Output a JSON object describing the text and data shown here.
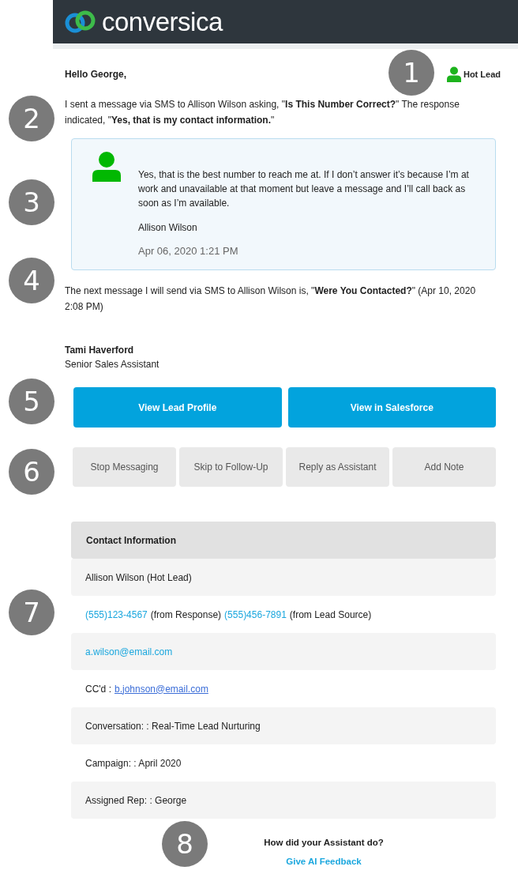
{
  "header": {
    "logo_text": "conversica"
  },
  "greeting": "Hello George,",
  "lead_status": {
    "label": "Hot Lead",
    "color": "#1db31d"
  },
  "intro": "I sent a message via SMS to Allison Wilson asking, \"**Is This Number Correct?**\" The response indicated, \"**Yes, that is my contact information.**\"",
  "message": {
    "text": "Yes, that is the best number to reach me at. If I don’t answer it’s because I’m at work and unavailable at that moment but leave a message and I’ll call back as soon as I’m available.",
    "sender": "Allison Wilson",
    "time": "Apr 06, 2020 1:21 PM"
  },
  "next_message": "The next message I will send via SMS to Allison Wilson is, \"**Were You Contacted?**\" (Apr 10, 2020 2:08 PM)",
  "signature": {
    "name": "Tami Haverford",
    "title": "Senior Sales Assistant"
  },
  "primary_buttons": [
    "View Lead Profile",
    "View in Salesforce"
  ],
  "secondary_buttons": [
    "Stop Messaging",
    "Skip to Follow-Up",
    "Reply as Assistant",
    "Add Note"
  ],
  "contact": {
    "title": "Contact Information",
    "rows": [
      {
        "parts": [
          {
            "kind": "text",
            "text": "Allison Wilson (Hot Lead)"
          }
        ]
      },
      {
        "parts": [
          {
            "kind": "link",
            "text": "(555)123-4567"
          },
          {
            "kind": "text",
            "text": "(from Response)"
          },
          {
            "kind": "link",
            "text": "(555)456-7891"
          },
          {
            "kind": "text",
            "text": "(from Lead Source)"
          }
        ]
      },
      {
        "parts": [
          {
            "kind": "link",
            "text": "a.wilson@email.com"
          }
        ]
      },
      {
        "parts": [
          {
            "kind": "text",
            "text": "CC'd :"
          },
          {
            "kind": "underlined",
            "text": "b.johnson@email.com"
          }
        ]
      },
      {
        "parts": [
          {
            "kind": "text",
            "text": "Conversation: : Real-Time Lead Nurturing"
          }
        ]
      },
      {
        "parts": [
          {
            "kind": "text",
            "text": "Campaign: : April 2020"
          }
        ]
      },
      {
        "parts": [
          {
            "kind": "text",
            "text": "Assigned Rep: : George"
          }
        ]
      }
    ]
  },
  "feedback": {
    "question": "How did your Assistant do?",
    "link": "Give AI Feedback"
  },
  "callouts": [
    "1",
    "2",
    "3",
    "4",
    "5",
    "6",
    "7",
    "8"
  ]
}
